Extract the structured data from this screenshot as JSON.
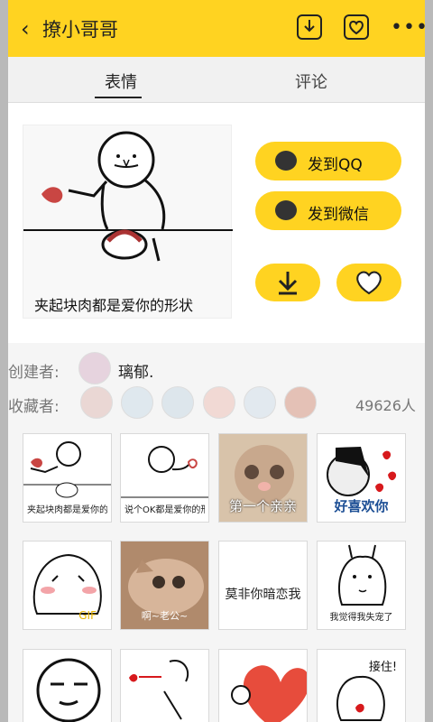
{
  "header": {
    "back_icon": "back-icon",
    "title": "撩小哥哥",
    "download_icon": "download-icon",
    "favorite_icon": "favorite-icon",
    "more_icon": "more-icon"
  },
  "tabs": [
    "表情",
    "评论"
  ],
  "preview": {
    "caption": "夹起块肉都是爱你的形状"
  },
  "actions": {
    "send_qq": "发到QQ",
    "send_wechat": "发到微信",
    "download_icon": "download-icon",
    "heart_icon": "heart-icon"
  },
  "creator": {
    "label": "创建者:",
    "name": "璃郁."
  },
  "collectors": {
    "label": "收藏者:",
    "count": "49626人"
  },
  "cards": [
    {
      "caption": "夹起块肉都是爱你的形状"
    },
    {
      "caption": "说个OK都是爱你的形状"
    },
    {
      "caption": "第一个亲亲"
    },
    {
      "caption": "好喜欢你"
    },
    {
      "caption": "GIF"
    },
    {
      "caption": "啊~老公~"
    },
    {
      "caption": "莫非你暗恋我"
    },
    {
      "caption": "我觉得我失宠了"
    },
    {
      "caption": ""
    },
    {
      "caption": ""
    },
    {
      "caption": ""
    },
    {
      "caption": "接住!"
    }
  ],
  "colors": {
    "accent": "#ffd321",
    "text": "#222222",
    "muted": "#777777"
  }
}
